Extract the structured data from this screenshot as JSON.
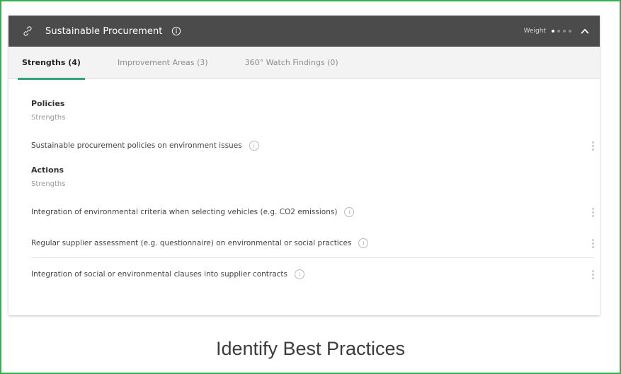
{
  "header": {
    "title": "Sustainable Procurement",
    "weight_label": "Weight",
    "weight_level": 1,
    "weight_max": 4
  },
  "tabs": [
    {
      "label": "Strengths (4)",
      "active": true
    },
    {
      "label": "Improvement Areas (3)",
      "active": false
    },
    {
      "label": "360° Watch Findings (0)",
      "active": false
    }
  ],
  "sections": [
    {
      "title": "Policies",
      "subtitle": "Strengths",
      "items": [
        "Sustainable procurement policies on environment issues"
      ]
    },
    {
      "title": "Actions",
      "subtitle": "Strengths",
      "items": [
        "Integration of environmental criteria when selecting vehicles (e.g. CO2 emissions)",
        "Regular supplier assessment (e.g. questionnaire) on environmental or social practices",
        "Integration of social or environmental clauses into supplier contracts"
      ]
    }
  ],
  "caption": "Identify Best Practices",
  "colors": {
    "frame": "#2fb34a",
    "header_bg": "#4b4b4b",
    "tab_underline": "#2fa37b"
  }
}
